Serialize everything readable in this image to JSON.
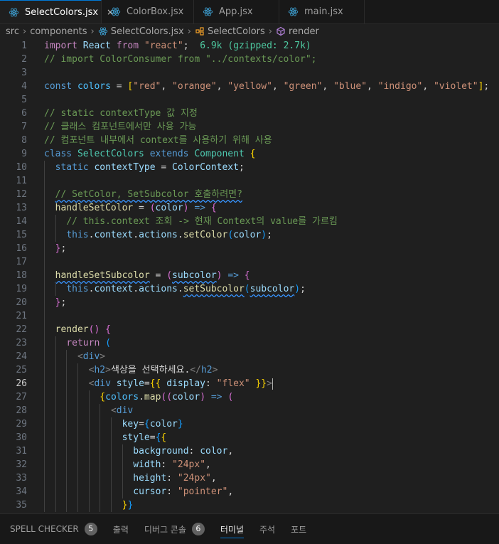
{
  "tabs": [
    {
      "label": "SelectColors.jsx",
      "active": true,
      "close": "×"
    },
    {
      "label": "ColorBox.jsx",
      "active": false
    },
    {
      "label": "App.jsx",
      "active": false
    },
    {
      "label": "main.jsx",
      "active": false
    }
  ],
  "breadcrumb": [
    "src",
    "components",
    "SelectColors.jsx",
    "SelectColors",
    "render"
  ],
  "cursor_line": 26,
  "lines": [
    {
      "n": 1,
      "i": 0,
      "t": [
        [
          "c",
          "import"
        ],
        [
          "p",
          " "
        ],
        [
          "v",
          "React"
        ],
        [
          "p",
          " "
        ],
        [
          "c",
          "from"
        ],
        [
          "p",
          " "
        ],
        [
          "s",
          "\"react\""
        ],
        [
          "p",
          ";  "
        ],
        [
          "hint",
          "6.9k (gzipped: 2.7k)"
        ]
      ]
    },
    {
      "n": 2,
      "i": 0,
      "t": [
        [
          "cm",
          "// import ColorConsumer from \"../contexts/color\";"
        ]
      ]
    },
    {
      "n": 3,
      "i": 0,
      "t": []
    },
    {
      "n": 4,
      "i": 0,
      "t": [
        [
          "k",
          "const"
        ],
        [
          "p",
          " "
        ],
        [
          "cn",
          "colors"
        ],
        [
          "p",
          " = "
        ],
        [
          "b1",
          "["
        ],
        [
          "s",
          "\"red\""
        ],
        [
          "p",
          ", "
        ],
        [
          "s",
          "\"orange\""
        ],
        [
          "p",
          ", "
        ],
        [
          "s",
          "\"yellow\""
        ],
        [
          "p",
          ", "
        ],
        [
          "s",
          "\"green\""
        ],
        [
          "p",
          ", "
        ],
        [
          "s",
          "\"blue\""
        ],
        [
          "p",
          ", "
        ],
        [
          "s",
          "\"indigo\""
        ],
        [
          "p",
          ", "
        ],
        [
          "s",
          "\"violet\""
        ],
        [
          "b1",
          "]"
        ],
        [
          "p",
          ";"
        ]
      ]
    },
    {
      "n": 5,
      "i": 0,
      "t": []
    },
    {
      "n": 6,
      "i": 0,
      "t": [
        [
          "cm",
          "// static contextType 값 지정"
        ]
      ]
    },
    {
      "n": 7,
      "i": 0,
      "t": [
        [
          "cm",
          "// 클래스 컴포넌트에서만 사용 가능"
        ]
      ]
    },
    {
      "n": 8,
      "i": 0,
      "t": [
        [
          "cm",
          "// 컴포넌트 내부에서 context를 사용하기 위해 사용"
        ]
      ]
    },
    {
      "n": 9,
      "i": 0,
      "t": [
        [
          "k",
          "class"
        ],
        [
          "p",
          " "
        ],
        [
          "t",
          "SelectColors"
        ],
        [
          "p",
          " "
        ],
        [
          "k",
          "extends"
        ],
        [
          "p",
          " "
        ],
        [
          "t",
          "Component"
        ],
        [
          "p",
          " "
        ],
        [
          "b1",
          "{"
        ]
      ]
    },
    {
      "n": 10,
      "i": 1,
      "t": [
        [
          "k",
          "static"
        ],
        [
          "p",
          " "
        ],
        [
          "v",
          "contextType"
        ],
        [
          "p",
          " = "
        ],
        [
          "v",
          "ColorContext"
        ],
        [
          "p",
          ";"
        ]
      ]
    },
    {
      "n": 11,
      "i": 1,
      "t": []
    },
    {
      "n": 12,
      "i": 1,
      "t": [
        [
          "cm",
          "// SetColor, SetSubcolor 호출하려면?"
        ]
      ]
    },
    {
      "n": 13,
      "i": 1,
      "t": [
        [
          "f",
          "handleSetColor"
        ],
        [
          "p",
          " = "
        ],
        [
          "b2",
          "("
        ],
        [
          "v",
          "color"
        ],
        [
          "b2",
          ")"
        ],
        [
          "p",
          " "
        ],
        [
          "k",
          "=>"
        ],
        [
          "p",
          " "
        ],
        [
          "b2",
          "{"
        ]
      ]
    },
    {
      "n": 14,
      "i": 2,
      "t": [
        [
          "cm",
          "// this.context 조회 -> 현재 Context의 value를 가르킴"
        ]
      ]
    },
    {
      "n": 15,
      "i": 2,
      "t": [
        [
          "k",
          "this"
        ],
        [
          "p",
          "."
        ],
        [
          "v",
          "context"
        ],
        [
          "p",
          "."
        ],
        [
          "v",
          "actions"
        ],
        [
          "p",
          "."
        ],
        [
          "f",
          "setColor"
        ],
        [
          "b3",
          "("
        ],
        [
          "v",
          "color"
        ],
        [
          "b3",
          ")"
        ],
        [
          "p",
          ";"
        ]
      ]
    },
    {
      "n": 16,
      "i": 1,
      "t": [
        [
          "b2",
          "}"
        ],
        [
          "p",
          ";"
        ]
      ]
    },
    {
      "n": 17,
      "i": 1,
      "t": []
    },
    {
      "n": 18,
      "i": 1,
      "t": [
        [
          "f",
          "handleSetSubcolor"
        ],
        [
          "p",
          " = "
        ],
        [
          "b2",
          "("
        ],
        [
          "v",
          "subcolor"
        ],
        [
          "b2",
          ")"
        ],
        [
          "p",
          " "
        ],
        [
          "k",
          "=>"
        ],
        [
          "p",
          " "
        ],
        [
          "b2",
          "{"
        ]
      ]
    },
    {
      "n": 19,
      "i": 2,
      "t": [
        [
          "k",
          "this"
        ],
        [
          "p",
          "."
        ],
        [
          "v",
          "context"
        ],
        [
          "p",
          "."
        ],
        [
          "v",
          "actions"
        ],
        [
          "p",
          "."
        ],
        [
          "f",
          "setSubcolor"
        ],
        [
          "b3",
          "("
        ],
        [
          "v",
          "subcolor"
        ],
        [
          "b3",
          ")"
        ],
        [
          "p",
          ";"
        ]
      ]
    },
    {
      "n": 20,
      "i": 1,
      "t": [
        [
          "b2",
          "}"
        ],
        [
          "p",
          ";"
        ]
      ]
    },
    {
      "n": 21,
      "i": 1,
      "t": []
    },
    {
      "n": 22,
      "i": 1,
      "t": [
        [
          "f",
          "render"
        ],
        [
          "b2",
          "()"
        ],
        [
          "p",
          " "
        ],
        [
          "b2",
          "{"
        ]
      ]
    },
    {
      "n": 23,
      "i": 2,
      "t": [
        [
          "c",
          "return"
        ],
        [
          "p",
          " "
        ],
        [
          "b3",
          "("
        ]
      ]
    },
    {
      "n": 24,
      "i": 3,
      "t": [
        [
          "tg",
          "<"
        ],
        [
          "tn",
          "div"
        ],
        [
          "tg",
          ">"
        ]
      ]
    },
    {
      "n": 25,
      "i": 4,
      "t": [
        [
          "tg",
          "<"
        ],
        [
          "tn",
          "h2"
        ],
        [
          "tg",
          ">"
        ],
        [
          "p",
          "색상을 선택하세요."
        ],
        [
          "tg",
          "</"
        ],
        [
          "tn",
          "h2"
        ],
        [
          "tg",
          ">"
        ]
      ]
    },
    {
      "n": 26,
      "i": 4,
      "t": [
        [
          "tg",
          "<"
        ],
        [
          "tn",
          "div"
        ],
        [
          "p",
          " "
        ],
        [
          "v",
          "style"
        ],
        [
          "p",
          "="
        ],
        [
          "b1",
          "{{"
        ],
        [
          "p",
          " "
        ],
        [
          "v",
          "display"
        ],
        [
          "p",
          ": "
        ],
        [
          "s",
          "\"flex\""
        ],
        [
          "p",
          " "
        ],
        [
          "b1",
          "}}"
        ],
        [
          "tg",
          ">"
        ]
      ]
    },
    {
      "n": 27,
      "i": 5,
      "t": [
        [
          "b1",
          "{"
        ],
        [
          "cn",
          "colors"
        ],
        [
          "p",
          "."
        ],
        [
          "f",
          "map"
        ],
        [
          "b2",
          "(("
        ],
        [
          "v",
          "color"
        ],
        [
          "b2",
          ")"
        ],
        [
          "p",
          " "
        ],
        [
          "k",
          "=>"
        ],
        [
          "p",
          " "
        ],
        [
          "b2",
          "("
        ]
      ]
    },
    {
      "n": 28,
      "i": 6,
      "t": [
        [
          "tg",
          "<"
        ],
        [
          "tn",
          "div"
        ]
      ]
    },
    {
      "n": 29,
      "i": 7,
      "t": [
        [
          "v",
          "key"
        ],
        [
          "p",
          "="
        ],
        [
          "b3",
          "{"
        ],
        [
          "v",
          "color"
        ],
        [
          "b3",
          "}"
        ]
      ]
    },
    {
      "n": 30,
      "i": 7,
      "t": [
        [
          "v",
          "style"
        ],
        [
          "p",
          "="
        ],
        [
          "b3",
          "{"
        ],
        [
          "b1",
          "{"
        ]
      ]
    },
    {
      "n": 31,
      "i": 8,
      "t": [
        [
          "v",
          "background"
        ],
        [
          "p",
          ": "
        ],
        [
          "v",
          "color"
        ],
        [
          "p",
          ","
        ]
      ]
    },
    {
      "n": 32,
      "i": 8,
      "t": [
        [
          "v",
          "width"
        ],
        [
          "p",
          ": "
        ],
        [
          "s",
          "\"24px\""
        ],
        [
          "p",
          ","
        ]
      ]
    },
    {
      "n": 33,
      "i": 8,
      "t": [
        [
          "v",
          "height"
        ],
        [
          "p",
          ": "
        ],
        [
          "s",
          "\"24px\""
        ],
        [
          "p",
          ","
        ]
      ]
    },
    {
      "n": 34,
      "i": 8,
      "t": [
        [
          "v",
          "cursor"
        ],
        [
          "p",
          ": "
        ],
        [
          "s",
          "\"pointer\""
        ],
        [
          "p",
          ","
        ]
      ]
    },
    {
      "n": 35,
      "i": 7,
      "t": [
        [
          "b1",
          "}"
        ],
        [
          "b3",
          "}"
        ]
      ]
    }
  ],
  "panel": [
    {
      "label": "SPELL CHECKER",
      "badge": "5",
      "active": false
    },
    {
      "label": "출력",
      "badge": null,
      "active": false
    },
    {
      "label": "디버그 콘솔",
      "badge": "6",
      "active": false
    },
    {
      "label": "터미널",
      "badge": null,
      "active": true
    },
    {
      "label": "주석",
      "badge": null,
      "active": false
    },
    {
      "label": "포트",
      "badge": null,
      "active": false
    }
  ]
}
